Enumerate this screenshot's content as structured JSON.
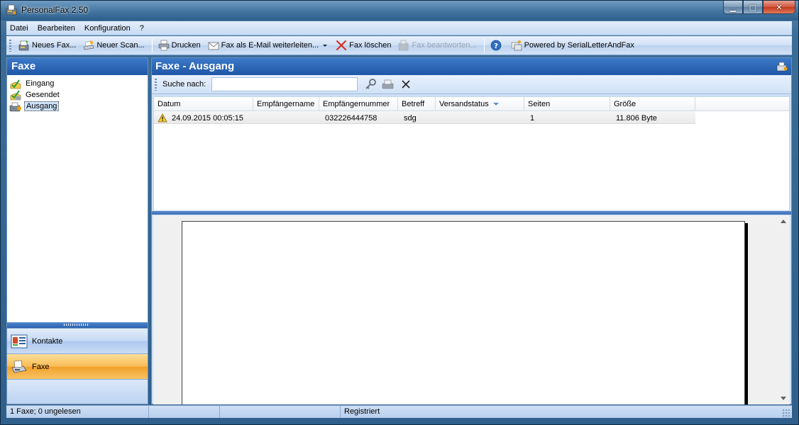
{
  "window": {
    "title": "PersonalFax 2.50",
    "controls": {
      "minimize": "▁",
      "maximize": "▢",
      "close": "✕"
    }
  },
  "menu": {
    "items": [
      {
        "label": "Datei"
      },
      {
        "label": "Bearbeiten"
      },
      {
        "label": "Konfiguration"
      },
      {
        "label": "?"
      }
    ]
  },
  "toolbar": {
    "new_fax": "Neues Fax...",
    "new_scan": "Neuer Scan...",
    "print": "Drucken",
    "forward_email": "Fax als E-Mail weiterleiten...",
    "delete_fax": "Fax löschen",
    "reply_fax": "Fax beantworten...",
    "powered_by": "Powered by SerialLetterAndFax"
  },
  "sidebar": {
    "title": "Faxe",
    "folders": [
      {
        "label": "Eingang",
        "icon": "inbox-icon"
      },
      {
        "label": "Gesendet",
        "icon": "sent-icon"
      },
      {
        "label": "Ausgang",
        "icon": "outbox-icon",
        "selected": true
      }
    ],
    "nav": {
      "contacts": "Kontakte",
      "faxes": "Faxe"
    }
  },
  "main": {
    "title": "Faxe - Ausgang",
    "search": {
      "label": "Suche nach:",
      "value": "",
      "placeholder": ""
    },
    "table": {
      "columns": [
        "Datum",
        "Empfängername",
        "Empfängernummer",
        "Betreff",
        "Versandstatus",
        "Seiten",
        "Größe"
      ],
      "rows": [
        {
          "status_icon": "warning-icon",
          "datum": "24.09.2015 00:05:15",
          "empfaengername": "",
          "empfaengernummer": "032226444758",
          "betreff": "sdg",
          "versandstatus": "",
          "seiten": "1",
          "groesse": "11.806 Byte"
        }
      ]
    }
  },
  "statusbar": {
    "summary": "1 Faxe; 0 ungelesen",
    "panel2": "",
    "panel3": "",
    "registration": "Registriert"
  },
  "colors": {
    "header_blue": "#1f57a6",
    "nav_selected_orange": "#f1a02a",
    "delete_red": "#d42a1e"
  }
}
